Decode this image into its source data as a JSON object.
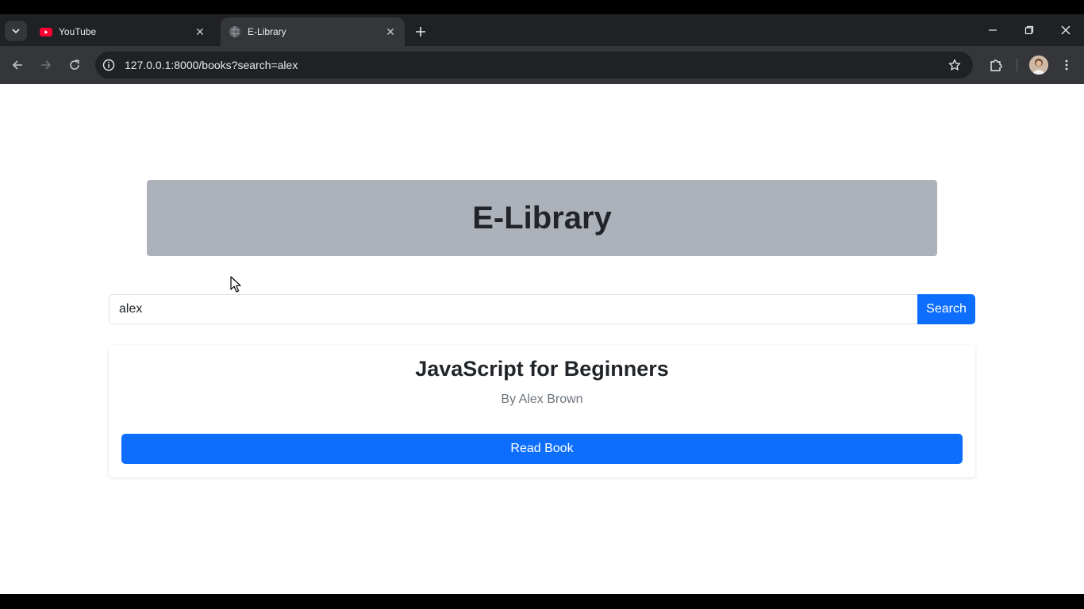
{
  "browser": {
    "tabs": [
      {
        "title": "YouTube",
        "favicon": "youtube-icon",
        "active": false
      },
      {
        "title": "E-Library",
        "favicon": "globe-icon",
        "active": true
      }
    ],
    "url": "127.0.0.1:8000/books?search=alex"
  },
  "page": {
    "header_title": "E-Library",
    "search": {
      "value": "alex",
      "button_label": "Search"
    },
    "results": [
      {
        "title": "JavaScript for Beginners",
        "author": "By Alex Brown",
        "button_label": "Read Book"
      }
    ]
  },
  "colors": {
    "primary": "#0d6efd",
    "header_bg": "#adb1b9",
    "chrome_dark": "#202124",
    "chrome_toolbar": "#35363a"
  }
}
